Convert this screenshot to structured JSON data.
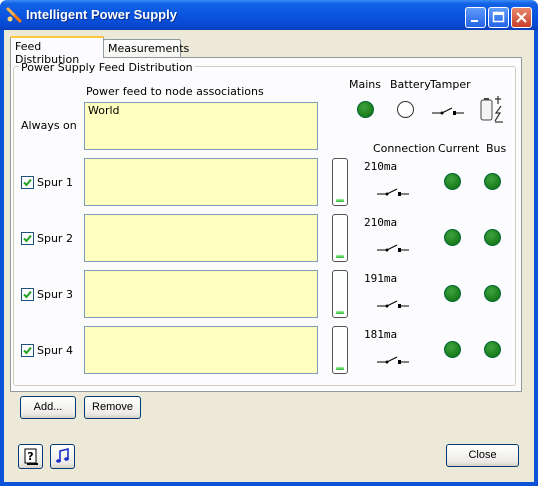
{
  "window": {
    "title": "Intelligent Power Supply"
  },
  "tabs": [
    {
      "label": "Feed Distribution"
    },
    {
      "label": "Measurements"
    }
  ],
  "group": {
    "legend": "Power Supply Feed Distribution"
  },
  "headers": {
    "mains": "Mains",
    "battery": "Battery",
    "tamper": "Tamper",
    "assoc": "Power feed to node associations",
    "connection": "Connection",
    "current": "Current",
    "bus": "Bus"
  },
  "status": {
    "mains": "on",
    "battery": "off",
    "tamper": "open",
    "status_colors": {
      "on": "#1e8a1e",
      "off": "#ffffff"
    }
  },
  "always_on": {
    "label": "Always on",
    "assoc_text": "World"
  },
  "spurs": [
    {
      "label": "Spur 1",
      "checked": true,
      "assoc_text": "",
      "current": "210ma",
      "level": 0.08,
      "current_ok": "on",
      "bus_ok": "on"
    },
    {
      "label": "Spur 2",
      "checked": true,
      "assoc_text": "",
      "current": "210ma",
      "level": 0.08,
      "current_ok": "on",
      "bus_ok": "on"
    },
    {
      "label": "Spur 3",
      "checked": true,
      "assoc_text": "",
      "current": "191ma",
      "level": 0.08,
      "current_ok": "on",
      "bus_ok": "on"
    },
    {
      "label": "Spur 4",
      "checked": true,
      "assoc_text": "",
      "current": "181ma",
      "level": 0.08,
      "current_ok": "on",
      "bus_ok": "on"
    }
  ],
  "buttons": {
    "add": "Add...",
    "remove": "Remove",
    "close": "Close"
  },
  "footer_icons": [
    "help-icon",
    "music-note-icon"
  ]
}
